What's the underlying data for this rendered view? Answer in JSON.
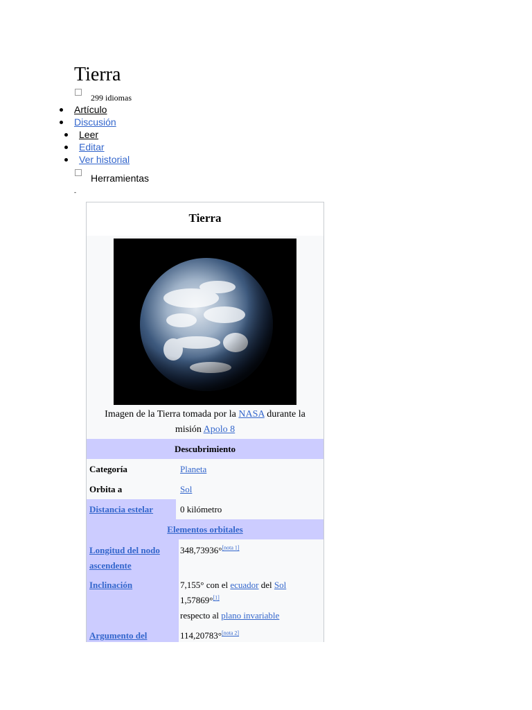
{
  "page": {
    "title": "Tierra"
  },
  "languages": {
    "label": "299 idiomas"
  },
  "namespaces": [
    {
      "label": "Artículo",
      "active": true
    },
    {
      "label": "Discusión",
      "active": false
    }
  ],
  "views": [
    {
      "label": "Leer",
      "active": true
    },
    {
      "label": "Editar",
      "active": false
    },
    {
      "label": "Ver historial",
      "active": false
    }
  ],
  "tools": {
    "label": "Herramientas"
  },
  "marker": "-",
  "infobox": {
    "title": "Tierra",
    "caption": {
      "prefix": "Imagen de la Tierra tomada por la ",
      "link1": "NASA",
      "middle": " durante la misión ",
      "link2": "Apolo 8"
    },
    "section_discovery": "Descubrimiento",
    "rows_discovery": [
      {
        "label": "Categoría",
        "value_link": "Planeta"
      },
      {
        "label": "Orbita a",
        "value_link": "Sol"
      },
      {
        "label": "Distancia estelar",
        "value": "0 kilómetro"
      }
    ],
    "section_orbital": "Elementos orbitales",
    "longitud": {
      "label": "Longitud del nodo ascendente",
      "value": "348,73936°",
      "note": "[nota 1]"
    },
    "inclinacion": {
      "label": "Inclinación",
      "line1_a": "7,155° con el ",
      "line1_link1": "ecuador",
      "line1_b": " del ",
      "line1_link2": "Sol",
      "line2": "1,57869°",
      "line2_note": "[1]",
      "line3_a": "respecto al ",
      "line3_link": "plano invariable"
    },
    "argumento": {
      "label": "Argumento del",
      "value": "114,20783°",
      "note": "[nota 2]"
    }
  },
  "colors": {
    "link": "#3366cc",
    "infobox_header": "#ccccff",
    "infobox_bg": "#f8f9fa"
  }
}
